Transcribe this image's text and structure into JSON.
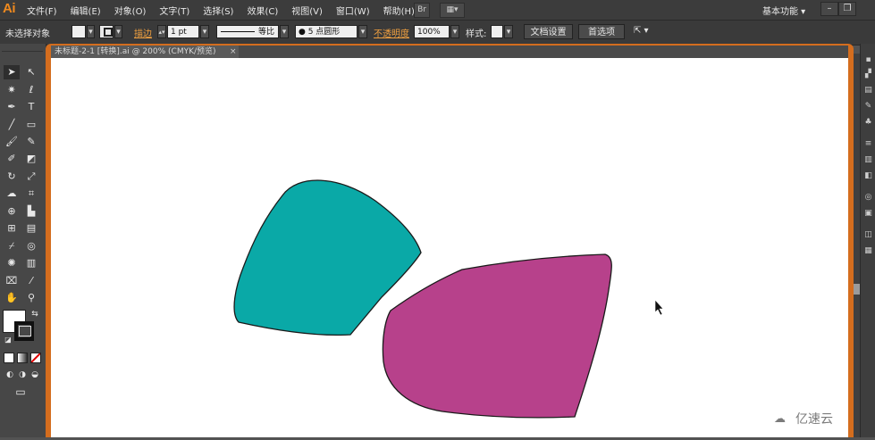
{
  "app": {
    "logo": "Ai"
  },
  "menubar": {
    "items": [
      "文件(F)",
      "编辑(E)",
      "对象(O)",
      "文字(T)",
      "选择(S)",
      "效果(C)",
      "视图(V)",
      "窗口(W)",
      "帮助(H)"
    ],
    "bridge_label": "Br",
    "workspace": "基本功能",
    "minimize": "–",
    "restore": "❐"
  },
  "control_bar": {
    "selection_status": "未选择对象",
    "stroke_label": "描边",
    "stroke_weight": "1 pt",
    "profile_label": "等比",
    "brush_label": "5 点圆形",
    "opacity_label": "不透明度",
    "opacity_value": "100%",
    "style_label": "样式:",
    "doc_setup_button": "文档设置",
    "preferences_button": "首选项"
  },
  "document_tab": {
    "title": "未标题-2-1 [转换].ai @ 200% (CMYK/预览)",
    "close": "×"
  },
  "canvas": {
    "shapes": [
      {
        "name": "teal-shape",
        "fill": "#0aa9a7"
      },
      {
        "name": "magenta-shape",
        "fill": "#b7418b"
      }
    ]
  },
  "colors": {
    "frame_accent": "#d46d1e",
    "panel_bg": "#474747",
    "menubar_bg": "#3c3c3c"
  },
  "tools": [
    "selection-tool-icon",
    "direct-selection-tool-icon",
    "magic-wand-tool-icon",
    "lasso-tool-icon",
    "pen-tool-icon",
    "type-tool-icon",
    "line-tool-icon",
    "rectangle-tool-icon",
    "paintbrush-tool-icon",
    "pencil-tool-icon",
    "blob-brush-tool-icon",
    "eraser-tool-icon",
    "rotate-tool-icon",
    "scale-tool-icon",
    "warp-tool-icon",
    "free-transform-tool-icon",
    "shape-builder-tool-icon",
    "perspective-grid-tool-icon",
    "mesh-tool-icon",
    "gradient-tool-icon",
    "eyedropper-tool-icon",
    "blend-tool-icon",
    "symbol-sprayer-tool-icon",
    "column-graph-tool-icon",
    "artboard-tool-icon",
    "slice-tool-icon",
    "hand-tool-icon",
    "zoom-tool-icon"
  ],
  "watermark": {
    "text": "亿速云"
  }
}
